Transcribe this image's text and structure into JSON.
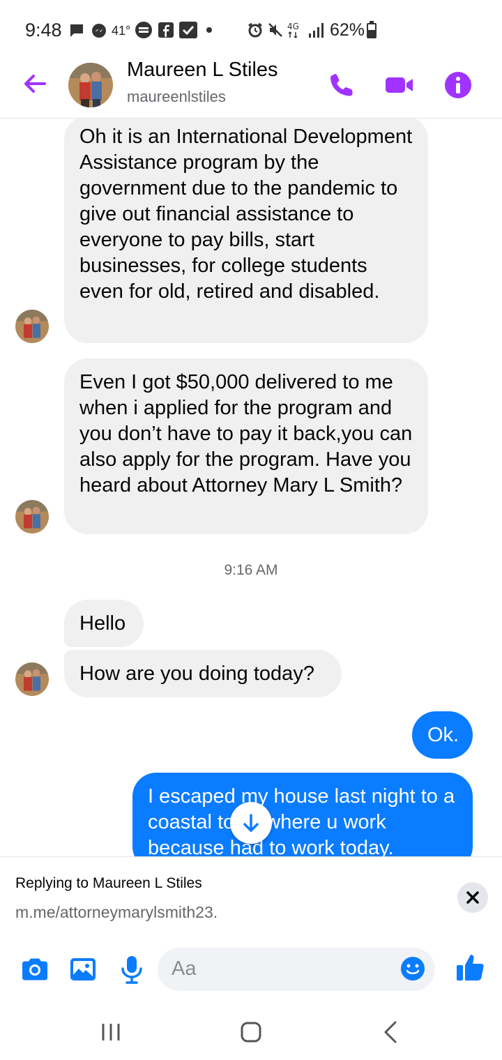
{
  "status_bar": {
    "time": "9:48",
    "temperature": "41°",
    "battery": "62%"
  },
  "header": {
    "name": "Maureen L Stiles",
    "username": "maureenlstiles"
  },
  "messages": [
    {
      "from": "them",
      "text": "Oh it is an International Development Assistance program by the government due to the pandemic to give out financial assistance to everyone to pay bills, start businesses, for college students even for old, retired and disabled."
    },
    {
      "from": "them",
      "text": "Even I got $50,000 delivered to me when i applied for the program and you don’t have to pay it back,you can also apply for the program. Have you heard about Attorney Mary L Smith?"
    },
    {
      "from": "them",
      "text": "Hello"
    },
    {
      "from": "them",
      "text": "How are you doing today?"
    },
    {
      "from": "me",
      "text": "Ok."
    },
    {
      "from": "me",
      "text": "I escaped my house last night to a coastal town where u work because had to work today."
    }
  ],
  "timestamp": "9:16 AM",
  "reply": {
    "title": "Replying to Maureen L Stiles",
    "text": "m.me/attorneymarylsmith23."
  },
  "composer": {
    "placeholder": "Aa"
  },
  "colors": {
    "accent_purple": "#a033ff",
    "outgoing_blue": "#0a7cff",
    "incoming_gray": "#f0f0f0"
  }
}
